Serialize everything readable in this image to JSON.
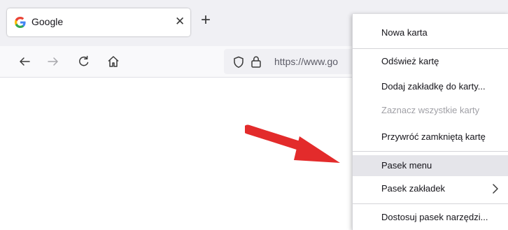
{
  "tab": {
    "title": "Google",
    "favicon": "google-g-icon",
    "close_glyph": "✕"
  },
  "new_tab_glyph": "+",
  "nav": {
    "back_icon": "arrow-left-icon",
    "forward_icon": "arrow-right-icon",
    "reload_icon": "reload-icon",
    "home_icon": "home-icon"
  },
  "urlbar": {
    "url": "https://www.go"
  },
  "context_menu": {
    "items": [
      {
        "label": "Nowa karta",
        "enabled": true
      },
      {
        "label": "Odśwież kartę",
        "enabled": true
      },
      {
        "label": "Dodaj zakładkę do karty...",
        "enabled": true
      },
      {
        "label": "Zaznacz wszystkie karty",
        "enabled": false
      },
      {
        "label": "Przywróć zamkniętą kartę",
        "enabled": true
      },
      {
        "label": "Pasek menu",
        "enabled": true,
        "highlighted": true
      },
      {
        "label": "Pasek zakładek",
        "enabled": true,
        "submenu": true
      },
      {
        "label": "Dostosuj pasek narzędzi...",
        "enabled": true
      }
    ]
  },
  "colors": {
    "arrow": "#e32b2b",
    "menu_highlight": "#e5e5ea",
    "disabled_text": "#a0a0a6"
  }
}
